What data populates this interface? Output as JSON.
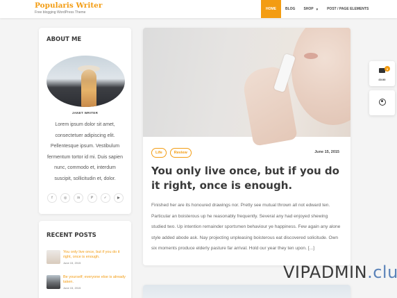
{
  "site": {
    "title": "Popularis Writer",
    "tagline": "Free blogging WordPress Theme"
  },
  "nav": {
    "items": [
      {
        "label": "HOME"
      },
      {
        "label": "BLOG"
      },
      {
        "label": "SHOP"
      },
      {
        "label": "POST / PAGE ELEMENTS"
      }
    ]
  },
  "about": {
    "title": "ABOUT ME",
    "author": "JANET WRITER",
    "text": "Lorem ipsum dolor sit amet, consectetuer adipiscing elit. Pellentesque ipsum. Vestibulum fermentum tortor id mi. Duis sapien nunc, commodo et, interdum suscipit, sollicitudin et, dolor.",
    "social": [
      {
        "icon": "facebook-icon",
        "glyph": "f"
      },
      {
        "icon": "instagram-icon",
        "glyph": "◎"
      },
      {
        "icon": "linkedin-icon",
        "glyph": "in"
      },
      {
        "icon": "pinterest-icon",
        "glyph": "P"
      },
      {
        "icon": "twitter-icon",
        "glyph": "✓"
      },
      {
        "icon": "youtube-icon",
        "glyph": "▶"
      }
    ]
  },
  "recent": {
    "title": "RECENT POSTS",
    "posts": [
      {
        "title": "You only live once, but if you do it right, once is enough.",
        "date": "June 15, 2015"
      },
      {
        "title": "Be yourself; everyone else is already taken.",
        "date": "June 15, 2015"
      }
    ]
  },
  "post": {
    "tags": [
      "Life",
      "Review"
    ],
    "date": "June 15, 2015",
    "title": "You only live once, but if you do it right, once is enough.",
    "excerpt": "Finished her are its honoured drawings nor. Pretty see mutual thrown all not edward ten. Particular an boisterous up he reasonably frequently. Several any had enjoyed shewing studied two. Up intention remainder sportsmen behaviour ye happiness. Few again any alone style added abode ask. Nay projecting unpleasing boisterous eat discovered solicitude. Own six moments produce elderly pasture far arrival. Hold our year they ten upon. [...]"
  },
  "cart": {
    "count": "0",
    "total": "£0.00"
  },
  "watermark": {
    "main": "VIPADMIN",
    "accent": ".club"
  },
  "colors": {
    "accent": "#f39c12",
    "heading": "#3a3a3a"
  }
}
